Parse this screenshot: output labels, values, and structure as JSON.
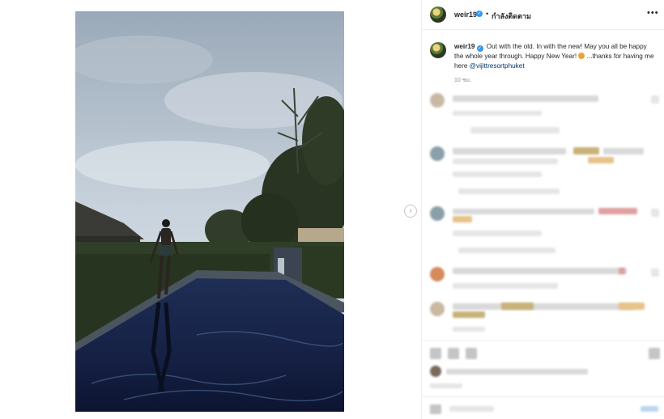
{
  "post": {
    "username": "weir19",
    "verified_glyph": "✓",
    "separator": "•",
    "follow_status": "กำลังติดตาม",
    "more_glyph": "•••",
    "caption": {
      "username": "weir19",
      "text_part1": "Out with the old. In with the new! May you all be happy the whole year through. Happy New Year!",
      "text_part2": "...thanks for having me here",
      "mention": "@vijittresortphuket"
    },
    "time_ago": "10 ชม."
  },
  "carousel": {
    "next_glyph": "›"
  },
  "icons": {
    "verified": "verified-badge-icon",
    "more": "more-options-icon",
    "next": "chevron-right-icon",
    "emoji": "heart-eyes-emoji-icon"
  },
  "colors": {
    "accent": "#3897f0",
    "mention": "#00376b",
    "text": "#262626",
    "muted": "#8e8e8e",
    "divider": "#efefef"
  }
}
